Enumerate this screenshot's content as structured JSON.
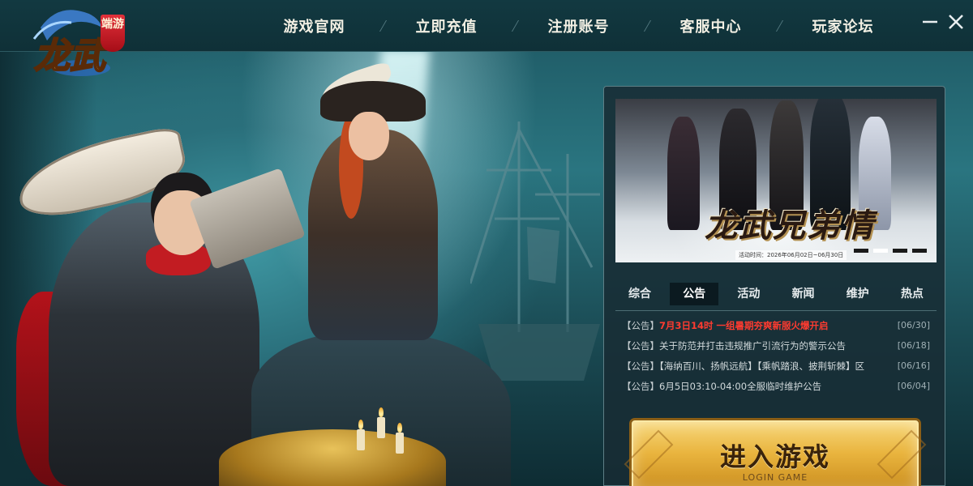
{
  "app": {
    "logo_text": "龙武",
    "logo_tag": "端游"
  },
  "nav": {
    "items": [
      {
        "label": "游戏官网"
      },
      {
        "label": "立即充值"
      },
      {
        "label": "注册账号"
      },
      {
        "label": "客服中心"
      },
      {
        "label": "玩家论坛"
      }
    ]
  },
  "window": {
    "minimize_icon": "minimize-icon",
    "close_icon": "close-icon"
  },
  "banner": {
    "title": "龙武兄弟情",
    "date_text": "活动时间：2026年06月02日~06月30日",
    "slides": 4,
    "active_slide": 1
  },
  "tabs": [
    {
      "label": "综合",
      "active": false
    },
    {
      "label": "公告",
      "active": true
    },
    {
      "label": "活动",
      "active": false
    },
    {
      "label": "新闻",
      "active": false
    },
    {
      "label": "维护",
      "active": false
    },
    {
      "label": "热点",
      "active": false
    }
  ],
  "news": [
    {
      "tag": "【公告】",
      "title": "7月3日14时 一组暑期夯爽新服火爆开启",
      "date": "[06/30]",
      "hot": true
    },
    {
      "tag": "【公告】",
      "title": "关于防范并打击违规推广引流行为的警示公告",
      "date": "[06/18]",
      "hot": false
    },
    {
      "tag": "【公告】",
      "title": "【海纳百川、扬帆远航】【乘帆踏浪、披荆斩棘】区",
      "date": "[06/16]",
      "hot": false
    },
    {
      "tag": "【公告】",
      "title": "6月5日03:10-04:00全服临时维护公告",
      "date": "[06/04]",
      "hot": false
    }
  ],
  "enter": {
    "label": "进入游戏",
    "sub": "LOGIN GAME"
  },
  "colors": {
    "accent_gold": "#e9b43e",
    "hot_red": "#ff3b30",
    "topbar": "#123941"
  }
}
